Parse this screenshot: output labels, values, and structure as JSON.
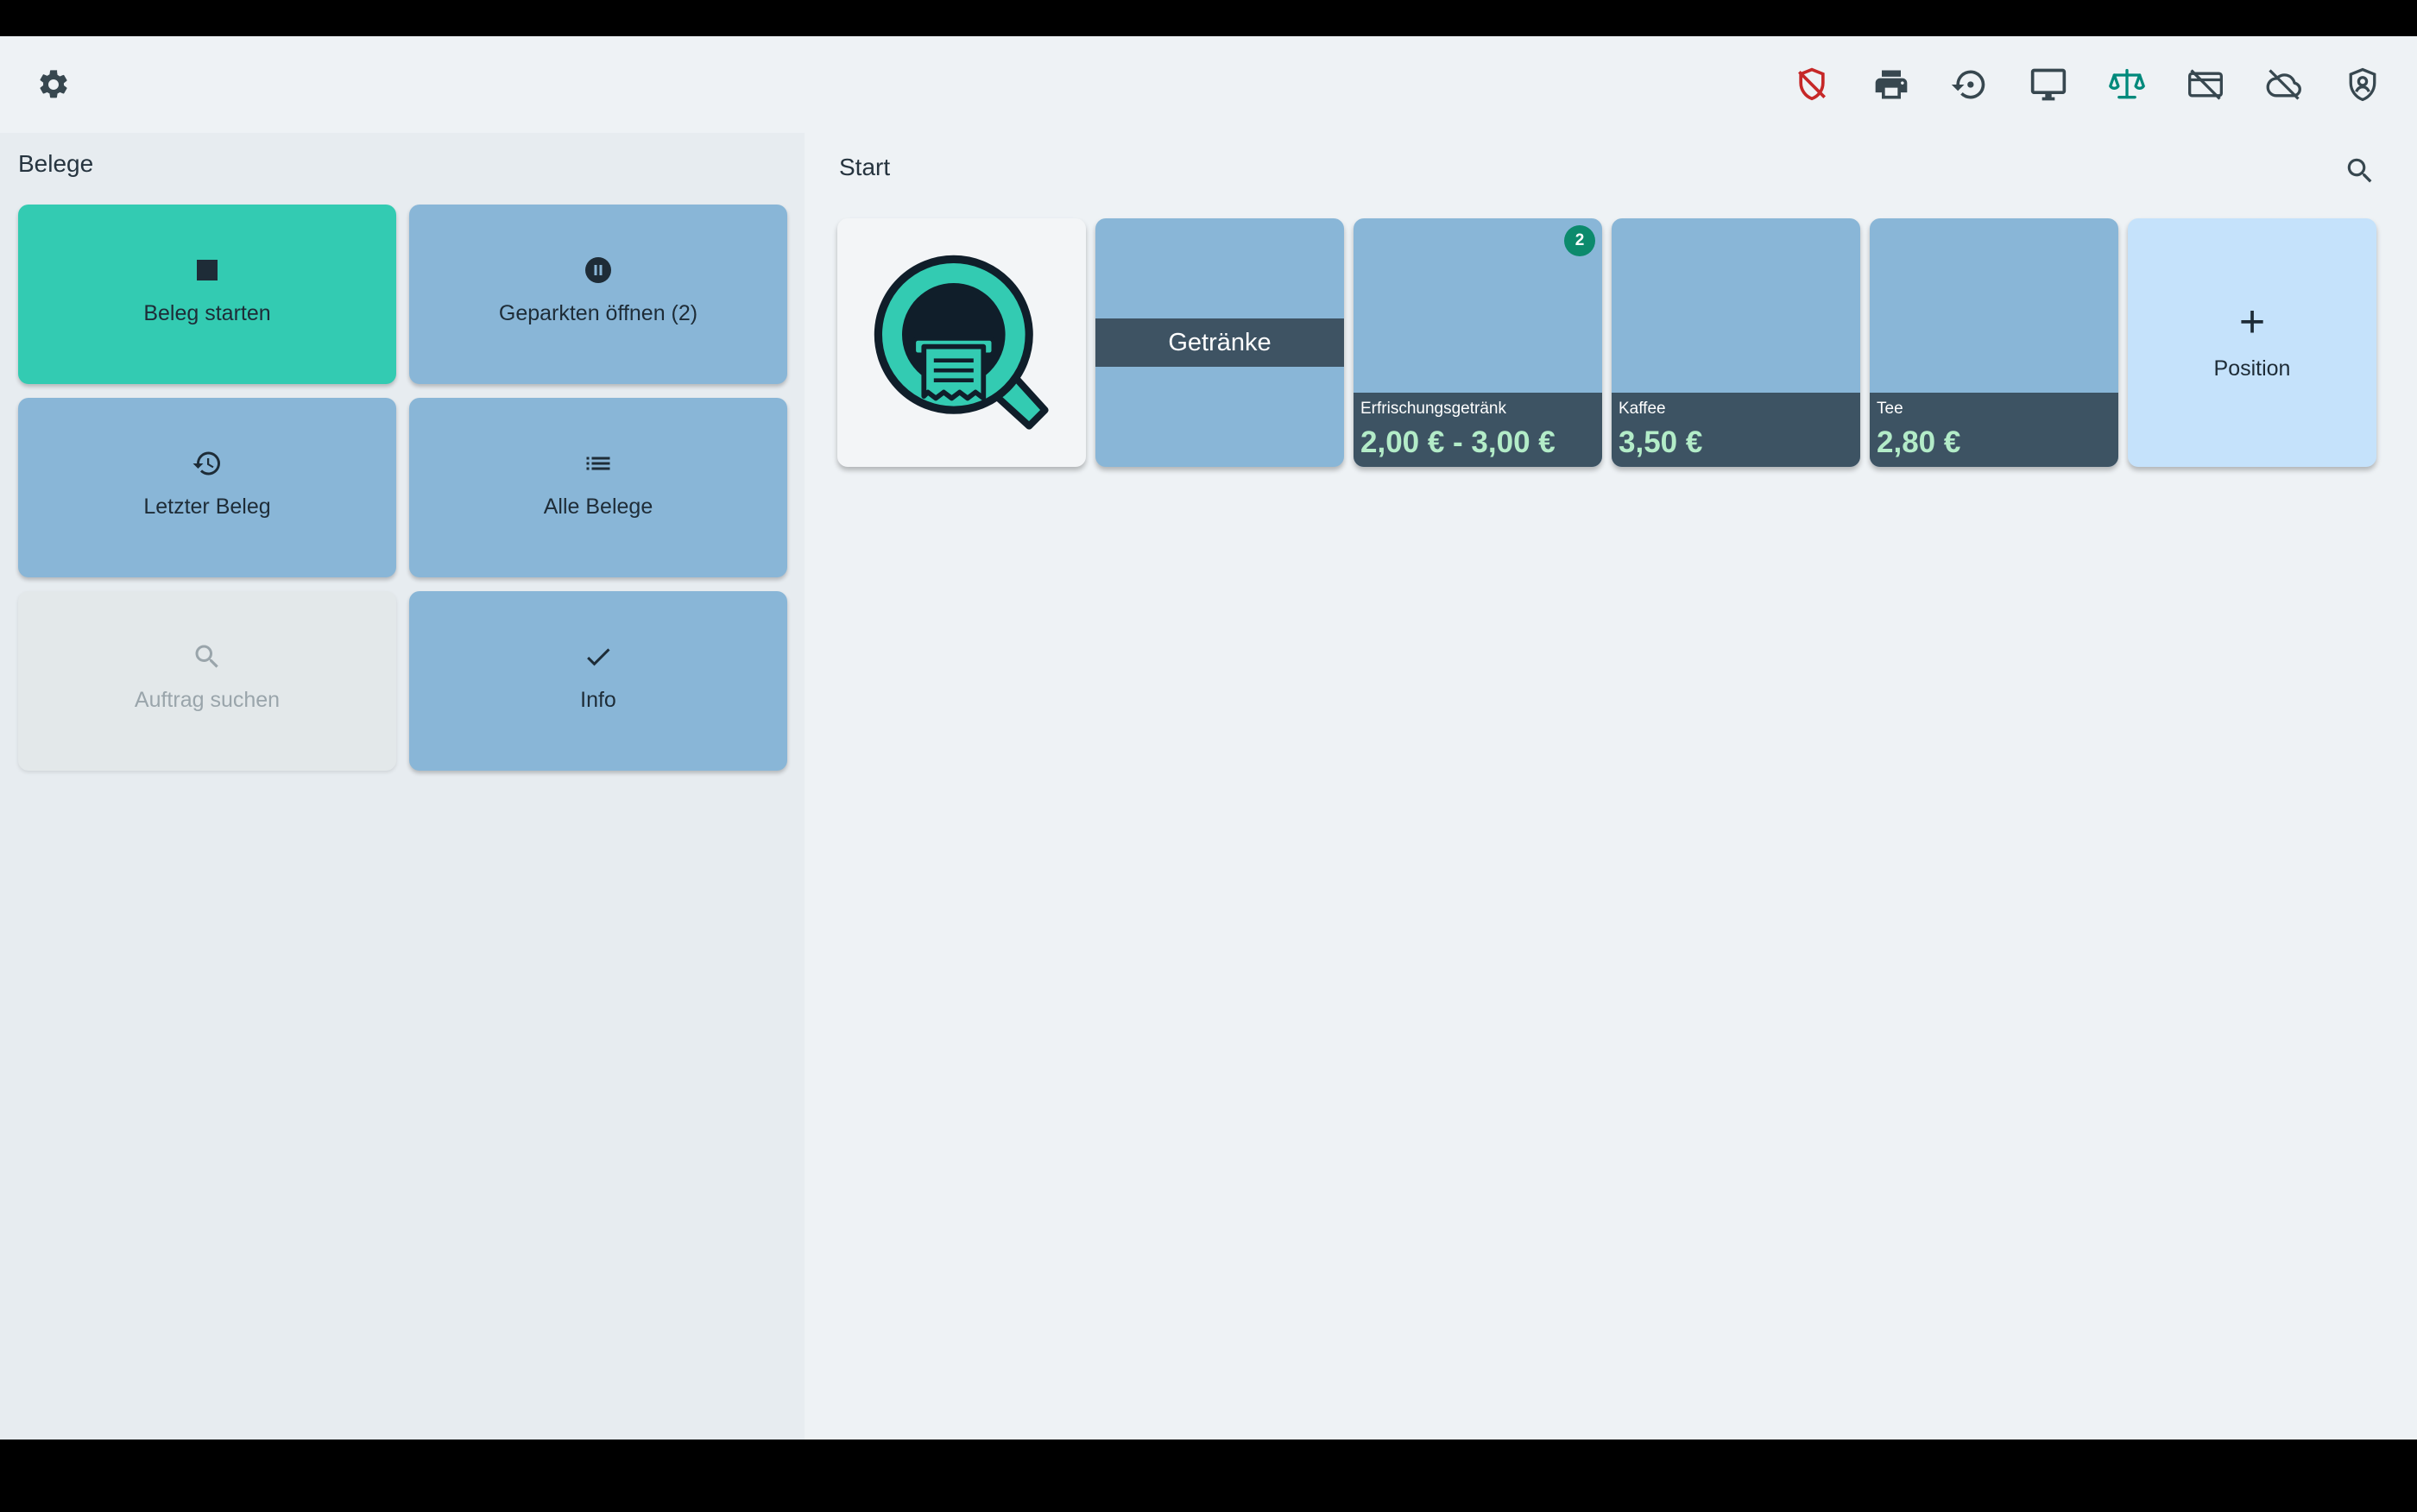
{
  "toolbar": {
    "icons": [
      "settings-icon",
      "shield-off-icon",
      "print-icon",
      "history-icon",
      "monitor-icon",
      "scale-icon",
      "payment-off-icon",
      "cloud-off-icon",
      "admin-shield-icon"
    ],
    "colors": {
      "shield_off": "#c62828",
      "scale": "#00897b",
      "default": "#37474f"
    }
  },
  "left_panel": {
    "title": "Belege",
    "tiles": [
      {
        "label": "Beleg starten",
        "icon": "stop-icon",
        "style": "primary"
      },
      {
        "label": "Geparkten öffnen (2)",
        "icon": "pause-circle-icon",
        "style": "normal"
      },
      {
        "label": "Letzter Beleg",
        "icon": "history-icon",
        "style": "normal"
      },
      {
        "label": "Alle Belege",
        "icon": "list-icon",
        "style": "normal"
      },
      {
        "label": "Auftrag suchen",
        "icon": "search-icon",
        "style": "disabled"
      },
      {
        "label": "Info",
        "icon": "check-icon",
        "style": "normal"
      }
    ]
  },
  "main": {
    "title": "Start",
    "category": {
      "label": "Getränke"
    },
    "products": [
      {
        "name": "Erfrischungsgetränk",
        "price": "2,00 € - 3,00 €",
        "badge": "2"
      },
      {
        "name": "Kaffee",
        "price": "3,50 €"
      },
      {
        "name": "Tee",
        "price": "2,80 €"
      }
    ],
    "add_tile": {
      "label": "Position"
    }
  },
  "colors": {
    "accent": "#33cbb2",
    "tile": "#89b6d7",
    "band": "#3d5363",
    "price": "#b3ecc8",
    "add_tile": "#c5e2fb"
  }
}
